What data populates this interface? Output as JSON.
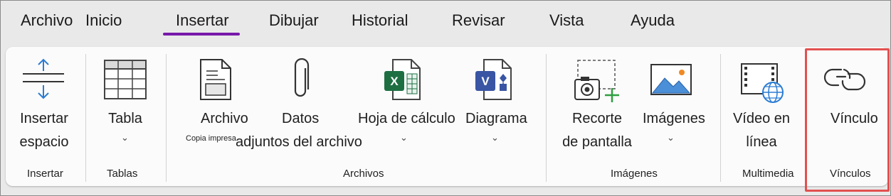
{
  "tabs": [
    "Archivo",
    "Inicio",
    "Insertar",
    "Dibujar",
    "Historial",
    "Revisar",
    "Vista",
    "Ayuda"
  ],
  "active_tab": "Insertar",
  "commands": {
    "insert_space": {
      "line1": "Insertar",
      "line2": "espacio",
      "icon": "insert-space-icon"
    },
    "table": {
      "label": "Tabla",
      "icon": "table-icon"
    },
    "file_printout": {
      "label": "Archivo",
      "sub": "Copia impresa",
      "icon": "file-printout-icon"
    },
    "file_attachment": {
      "label": "Datos",
      "sub": "adjuntos del archivo",
      "icon": "paperclip-icon"
    },
    "spreadsheet": {
      "label": "Hoja de cálculo",
      "icon": "excel-icon"
    },
    "diagram": {
      "label": "Diagrama",
      "icon": "visio-icon"
    },
    "screen_clipping": {
      "line1": "Recorte",
      "line2": "de pantalla",
      "icon": "screen-clipping-icon"
    },
    "images": {
      "label": "Imágenes",
      "icon": "image-icon"
    },
    "online_video": {
      "line1": "Vídeo en",
      "line2": "línea",
      "icon": "online-video-icon"
    },
    "link": {
      "label": "Vínculo",
      "icon": "link-icon"
    }
  },
  "groups": {
    "insert": "Insertar",
    "tables": "Tablas",
    "files": "Archivos",
    "images": "Imágenes",
    "multimedia": "Multimedia",
    "links": "Vínculos"
  },
  "chevron": "⌄",
  "colors": {
    "accent": "#7719aa",
    "highlight": "#e25050",
    "excel": "#1d6f42",
    "visio": "#3955a3"
  }
}
